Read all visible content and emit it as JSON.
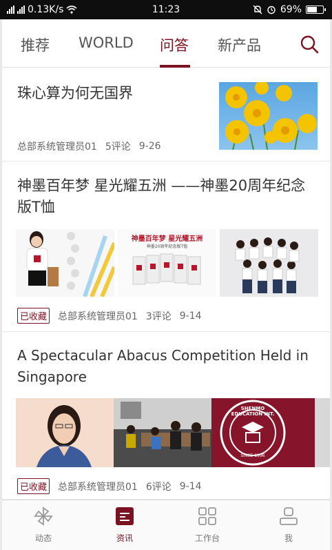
{
  "status_bar": {
    "network_speed": "0.13K/s",
    "time": "11:23",
    "battery": "69%",
    "battery_level": 0.69
  },
  "tabs": [
    {
      "label": "推荐",
      "active": false
    },
    {
      "label": "WORLD",
      "active": false
    },
    {
      "label": "问答",
      "active": true
    },
    {
      "label": "新产品",
      "active": false
    }
  ],
  "articles": [
    {
      "title": "珠心算为何无国界",
      "bookmarked": false,
      "author": "总部系统管理员01",
      "comments": "5评论",
      "date": "9-26"
    },
    {
      "title": "神墨百年梦 星光耀五洲 ——神墨20周年纪念版T恤",
      "bookmarked": true,
      "bookmark_label": "已收藏",
      "author": "总部系统管理员01",
      "comments": "3评论",
      "date": "9-14",
      "image2_text": "神墨百年梦 星光耀五洲",
      "image2_subtext": "神墨20周年纪念版T恤"
    },
    {
      "title": "A Spectacular Abacus Competition Held in Singapore",
      "bookmarked": true,
      "bookmark_label": "已收藏",
      "author": "总部系统管理员01",
      "comments": "6评论",
      "date": "9-14",
      "seal_text": "SHENMO EDUCATION INT.",
      "seal_since": "SINCE 1996"
    }
  ],
  "bottom_nav": [
    {
      "label": "动态",
      "icon": "pinwheel-icon",
      "active": false
    },
    {
      "label": "资讯",
      "icon": "news-icon",
      "active": true
    },
    {
      "label": "工作台",
      "icon": "grid-icon",
      "active": false
    },
    {
      "label": "我",
      "icon": "user-icon",
      "active": false
    }
  ],
  "colors": {
    "accent": "#7c1221",
    "text": "#333333",
    "meta": "#666666"
  }
}
